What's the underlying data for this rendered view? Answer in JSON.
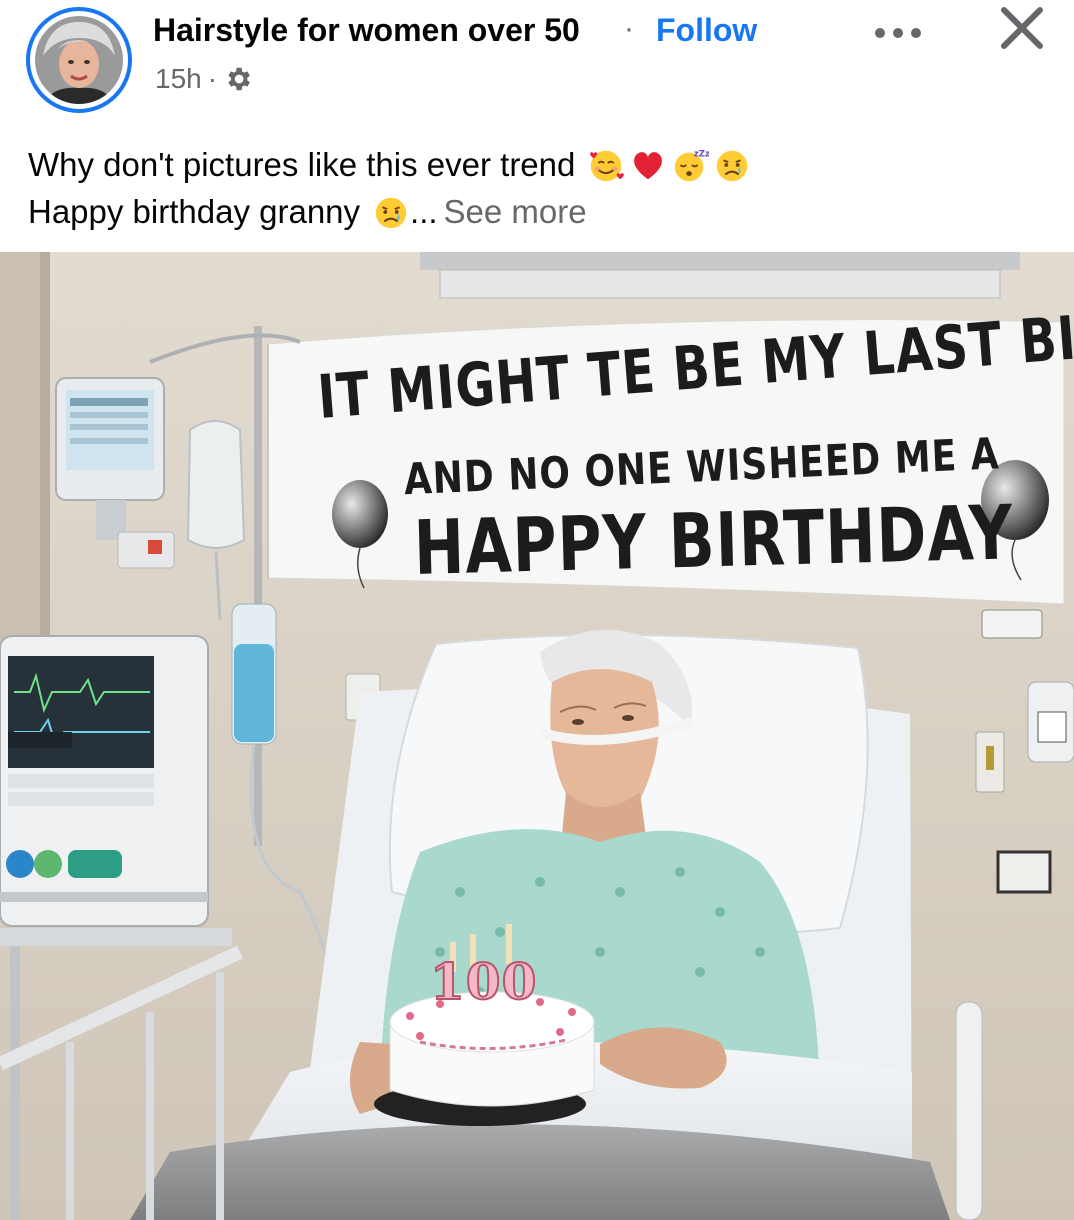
{
  "post": {
    "page_name": "Hairstyle for women over 50",
    "separator": "·",
    "follow_label": "Follow",
    "time": "15h",
    "meta_separator": "·",
    "audience_icon": "gear-icon",
    "caption_line1": "Why don't pictures like this ever trend",
    "caption_line2": "Happy birthday granny",
    "ellipsis": "...",
    "see_more_label": "See more",
    "emojis_line1": [
      "smiling-face-with-hearts",
      "red-heart",
      "sleeping-face",
      "sad-but-relieved-face"
    ],
    "emojis_line2": [
      "sad-but-relieved-face"
    ]
  },
  "image": {
    "banner_line1": "IT MIGHT TE BE MY LAST BIRTHDAY",
    "banner_line2": "AND NO ONE WISHEED ME A",
    "banner_line3": "HAPPY BIRTHDAY",
    "cake_number": "100"
  },
  "colors": {
    "accent": "#1877f2",
    "secondary_text": "#65676b",
    "primary_text": "#050505"
  }
}
